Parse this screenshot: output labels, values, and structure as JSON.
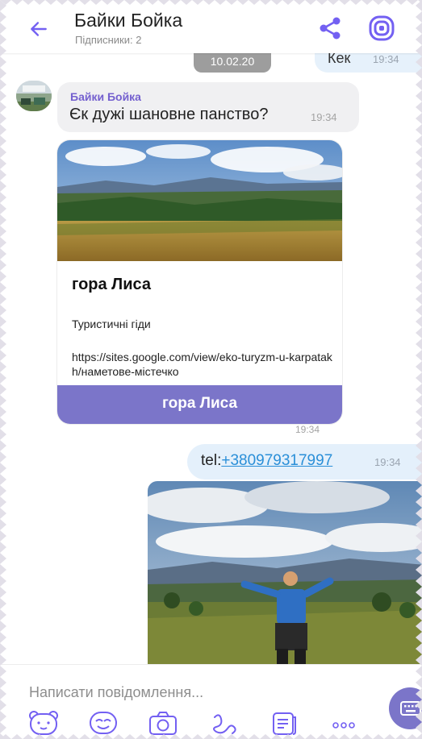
{
  "header": {
    "title": "Байки Бойка",
    "subtitle": "Підписники: 2",
    "back_icon": "arrow-left-icon",
    "share_icon": "share-icon",
    "viber_icon": "viber-logo-icon",
    "accent": "#7360f2"
  },
  "chat": {
    "date_pill": "10.02.20",
    "top_outgoing": {
      "text": "Кек",
      "time": "19:34"
    },
    "incoming": {
      "sender": "Байки Бойка",
      "text": "Єк дужі шановне панство?",
      "time": "19:34"
    },
    "link_card": {
      "title": "гора Лиса",
      "subtitle": "Туристичні гіди",
      "url": "https://sites.google.com/view/eko-turyzm-u-karpatakh/наметове-містечко",
      "button_label": "гора Лиса",
      "time": "19:34"
    },
    "tel_message": {
      "prefix": "tel:",
      "phone": "+380979317997",
      "time": "19:34"
    }
  },
  "composer": {
    "placeholder": "Написати повідомлення...",
    "tools": [
      "bear-sticker-icon",
      "emoji-icon",
      "camera-icon",
      "doodle-icon",
      "gif-icon",
      "more-icon"
    ],
    "keyboard_icon": "keyboard-icon",
    "button_color": "#7b75c9"
  }
}
